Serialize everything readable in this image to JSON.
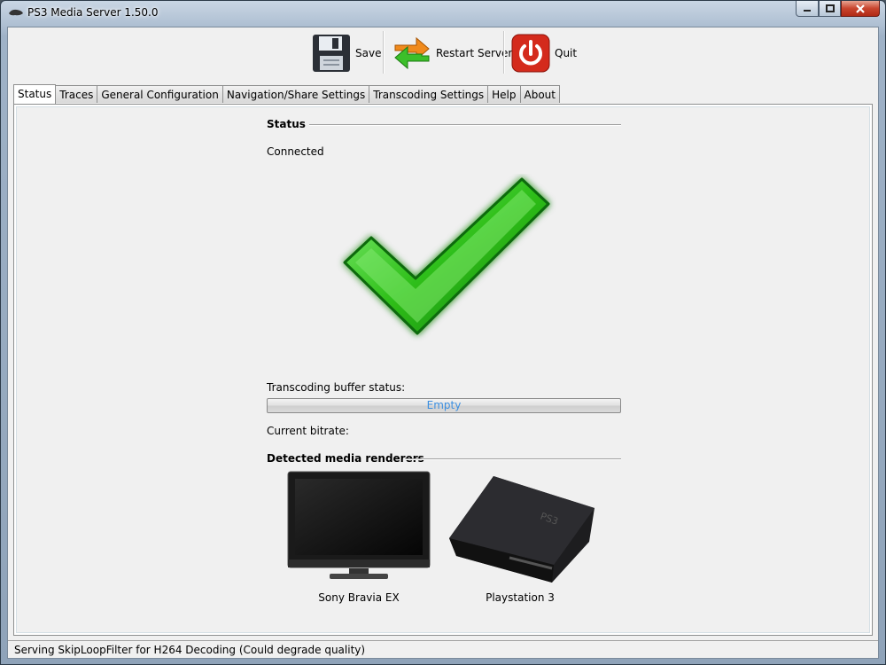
{
  "window": {
    "title": "PS3 Media Server 1.50.0"
  },
  "toolbar": {
    "save_label": "Save",
    "restart_label": "Restart Server",
    "quit_label": "Quit"
  },
  "tabs": [
    {
      "label": "Status",
      "active": true
    },
    {
      "label": "Traces"
    },
    {
      "label": "General Configuration"
    },
    {
      "label": "Navigation/Share Settings"
    },
    {
      "label": "Transcoding Settings"
    },
    {
      "label": "Help"
    },
    {
      "label": "About"
    }
  ],
  "status": {
    "section_title": "Status",
    "connection": "Connected",
    "buffer_label": "Transcoding buffer status:",
    "buffer_text": "Empty",
    "buffer_fill": 0.0,
    "bitrate_label": "Current bitrate:",
    "bitrate_value": "",
    "renderers_title": "Detected media renderers",
    "renderers": [
      {
        "name": "Sony Bravia EX",
        "icon": "tv-icon"
      },
      {
        "name": "Playstation 3",
        "icon": "ps3-console-icon"
      }
    ]
  },
  "status_bar": {
    "text": "Serving SkipLoopFilter for H264 Decoding (Could degrade quality)"
  },
  "colors": {
    "check_green": "#2fbf1a",
    "progress_text": "#3c8fe0",
    "quit_red": "#d42a1c"
  }
}
